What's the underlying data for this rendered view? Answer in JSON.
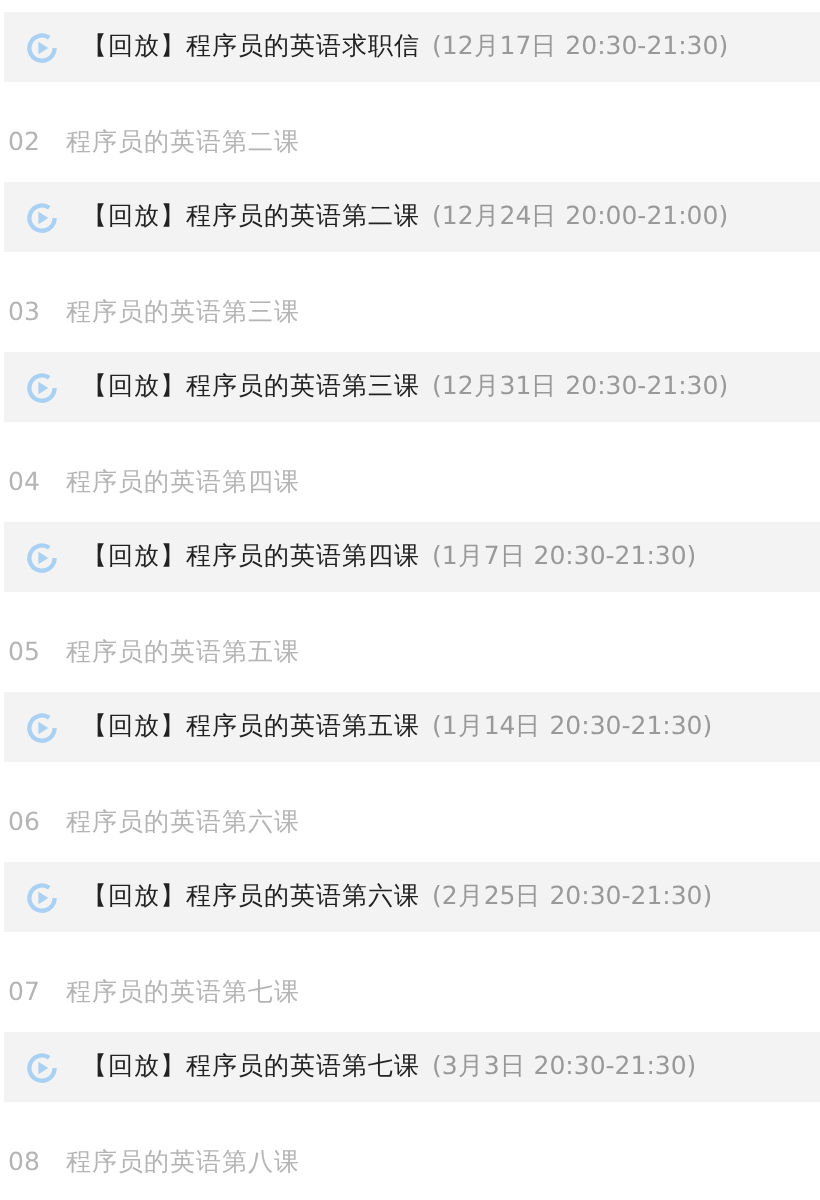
{
  "lessons": [
    {
      "replay": {
        "tag": "【回放】",
        "title": "程序员的英语求职信",
        "time": "(12月17日 20:30-21:30)"
      }
    },
    {
      "number": "02",
      "title": "程序员的英语第二课",
      "replay": {
        "tag": "【回放】",
        "title": "程序员的英语第二课",
        "time": "(12月24日 20:00-21:00)"
      }
    },
    {
      "number": "03",
      "title": "程序员的英语第三课",
      "replay": {
        "tag": "【回放】",
        "title": "程序员的英语第三课",
        "time": "(12月31日 20:30-21:30)"
      }
    },
    {
      "number": "04",
      "title": "程序员的英语第四课",
      "replay": {
        "tag": "【回放】",
        "title": "程序员的英语第四课",
        "time": "(1月7日 20:30-21:30)"
      }
    },
    {
      "number": "05",
      "title": "程序员的英语第五课",
      "replay": {
        "tag": "【回放】",
        "title": "程序员的英语第五课",
        "time": "(1月14日 20:30-21:30)"
      }
    },
    {
      "number": "06",
      "title": "程序员的英语第六课",
      "replay": {
        "tag": "【回放】",
        "title": "程序员的英语第六课",
        "time": "(2月25日 20:30-21:30)"
      }
    },
    {
      "number": "07",
      "title": "程序员的英语第七课",
      "replay": {
        "tag": "【回放】",
        "title": "程序员的英语第七课",
        "time": "(3月3日 20:30-21:30)"
      }
    },
    {
      "number": "08",
      "title": "程序员的英语第八课"
    }
  ]
}
